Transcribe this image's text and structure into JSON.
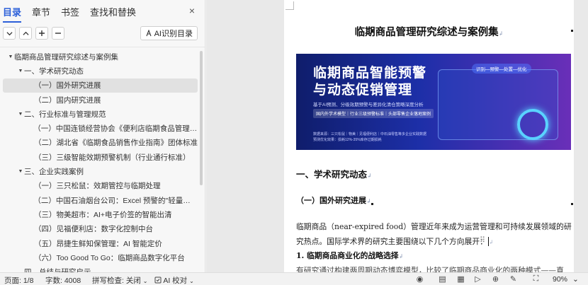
{
  "nav": {
    "tabs": [
      "目录",
      "章节",
      "书签",
      "查找和替换"
    ],
    "close": "×",
    "ai_toc_button": "AI识别目录",
    "toc": [
      {
        "text": "临期商品管理研究综述与案例集",
        "level": 0,
        "arrow": "▼"
      },
      {
        "text": "一、学术研究动态",
        "level": 1,
        "arrow": "▼"
      },
      {
        "text": "（一）国外研究进展",
        "level": 2,
        "arrow": "",
        "selected": true
      },
      {
        "text": "（二）国内研究进展",
        "level": 2,
        "arrow": ""
      },
      {
        "text": "二、行业标准与管理规范",
        "level": 1,
        "arrow": "▼"
      },
      {
        "text": "（一）中国连锁经营协会《便利店临期食品管理规范…",
        "level": 2,
        "arrow": ""
      },
      {
        "text": "（二）湖北省《临期食品销售作业指南》团体标准",
        "level": 2,
        "arrow": ""
      },
      {
        "text": "（三）三级智能效期预警机制（行业通行标准）",
        "level": 2,
        "arrow": ""
      },
      {
        "text": "三、企业实践案例",
        "level": 1,
        "arrow": "▼"
      },
      {
        "text": "（一）三只松鼠：效期管控与临期处理",
        "level": 2,
        "arrow": ""
      },
      {
        "text": "（二）中国石油烟台公司：Excel 预警的\"轻量化\"实…",
        "level": 2,
        "arrow": ""
      },
      {
        "text": "（三）物美超市：AI+电子价签的智能出清",
        "level": 2,
        "arrow": ""
      },
      {
        "text": "（四）见福便利店：数字化控制中台",
        "level": 2,
        "arrow": ""
      },
      {
        "text": "（五）昂捷生鲜知保管理：AI 智能定价",
        "level": 2,
        "arrow": ""
      },
      {
        "text": "（六）Too Good To Go：临期商品数字化平台",
        "level": 2,
        "arrow": ""
      },
      {
        "text": "四、总结与研究启示",
        "level": 1,
        "arrow": ""
      }
    ]
  },
  "doc": {
    "title": "临期商品管理研究综述与案例集",
    "banner": {
      "title_line1": "临期商品智能预警",
      "title_line2": "与动态促销管理",
      "subtitle": "基于AI预测、分级效期预警与差异化清仓策略深度分析",
      "chips": "国内外学术模型｜行业三级预警标准｜头部零售企业落地案例",
      "footer_line1": "数据来源：三只松鼠｜物美｜见福便利店｜中石油零售等多企业实践数据",
      "footer_line2": "预测优化效果：损耗12%-35%库存过期损耗",
      "flow": "识别—预警—处置—优化",
      "color_start": "#0f1d6b",
      "color_end": "#6a2fb8"
    },
    "h1": "一、学术研究动态",
    "h2": "（一）国外研究进展",
    "para": "临期商品（near-expired food）管理近年来成为运营管理和可持续发展领域的研究热点。国际学术界的研究主要围绕以下几个方向展开：",
    "h3": "1. 临期商品商业化的战略选择",
    "para2": "有研究通过构建两周期动态博弈模型，比较了临期商品商业化的两种模式——直"
  },
  "status": {
    "page": "页面: 1/8",
    "words": "字数: 4008",
    "spell": "拼写检查: 关闭",
    "ai_check": "AI 校对",
    "zoom": "90%"
  }
}
